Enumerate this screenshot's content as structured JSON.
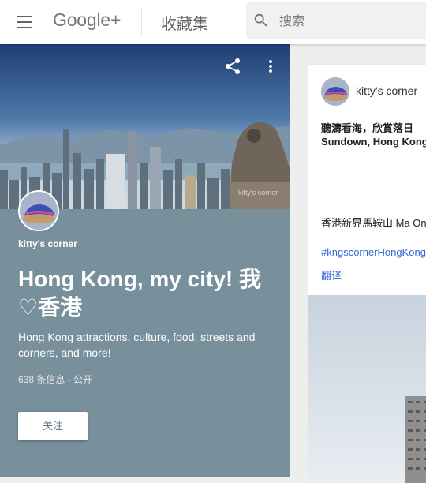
{
  "header": {
    "brand": "Google+",
    "section_title": "收藏集",
    "search_placeholder": "搜索"
  },
  "collection": {
    "owner": "kitty's corner",
    "title": "Hong Kong, my city! 我♡香港",
    "description": "Hong Kong attractions, culture, food, streets and corners, and more!",
    "meta": "638 条信息 - 公开",
    "follow_label": "关注",
    "cover_watermark": "kitty's corner"
  },
  "post": {
    "author": "kitty's corner",
    "title_zh": "聽濤看海，欣賞落日",
    "title_en": "Sundown, Hong Kong",
    "location": "香港新界馬鞍山 Ma On Shan",
    "hashtag": "#kngscornerHongKong",
    "translate_label": "翻译"
  },
  "colors": {
    "panel_bg": "#78909c",
    "link": "#3367d6",
    "page_bg": "#eeeeee"
  },
  "icons": [
    "menu-icon",
    "search-icon",
    "share-icon",
    "more-vert-icon"
  ]
}
